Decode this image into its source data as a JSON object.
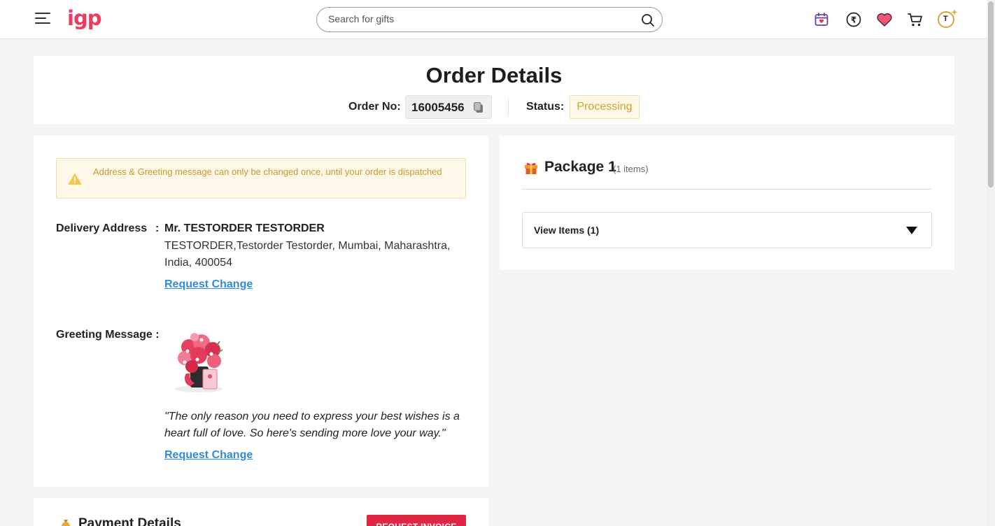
{
  "header": {
    "logo": "igp",
    "search_placeholder": "Search for gifts",
    "avatar_initial": "T"
  },
  "order": {
    "title": "Order Details",
    "order_no_label": "Order No:",
    "order_no": "16005456",
    "status_label": "Status:",
    "status": "Processing"
  },
  "notice": {
    "text": "Address & Greeting message can only be changed once, until your order is dispatched"
  },
  "delivery": {
    "label": "Delivery Address",
    "colon": ":",
    "name": "Mr. TESTORDER TESTORDER",
    "address": "TESTORDER,Testorder Testorder, Mumbai, Maharashtra, India, 400054",
    "change_link": "Request Change"
  },
  "greeting": {
    "label": "Greeting Message :",
    "message": "\"The only reason you need to express your best wishes is a heart full of love. So here's sending more love your way.\"",
    "change_link": "Request Change"
  },
  "payment": {
    "title": "Payment Details",
    "invoice_button": "REQUEST INVOICE"
  },
  "package": {
    "title": "Package 1",
    "count": "(1 items)",
    "view_items": "View Items (1)"
  },
  "colors": {
    "brand": "#ef3b5e",
    "link": "#2f8be0",
    "status_text": "#d4a02c",
    "button": "#e02745"
  }
}
